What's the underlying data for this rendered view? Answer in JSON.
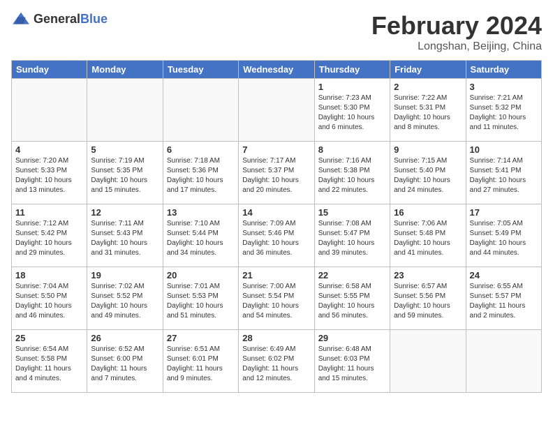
{
  "header": {
    "logo_general": "General",
    "logo_blue": "Blue",
    "month_title": "February 2024",
    "location": "Longshan, Beijing, China"
  },
  "weekdays": [
    "Sunday",
    "Monday",
    "Tuesday",
    "Wednesday",
    "Thursday",
    "Friday",
    "Saturday"
  ],
  "weeks": [
    [
      {
        "day": "",
        "sunrise": "",
        "sunset": "",
        "daylight": "",
        "empty": true
      },
      {
        "day": "",
        "sunrise": "",
        "sunset": "",
        "daylight": "",
        "empty": true
      },
      {
        "day": "",
        "sunrise": "",
        "sunset": "",
        "daylight": "",
        "empty": true
      },
      {
        "day": "",
        "sunrise": "",
        "sunset": "",
        "daylight": "",
        "empty": true
      },
      {
        "day": "1",
        "sunrise": "Sunrise: 7:23 AM",
        "sunset": "Sunset: 5:30 PM",
        "daylight": "Daylight: 10 hours and 6 minutes.",
        "empty": false
      },
      {
        "day": "2",
        "sunrise": "Sunrise: 7:22 AM",
        "sunset": "Sunset: 5:31 PM",
        "daylight": "Daylight: 10 hours and 8 minutes.",
        "empty": false
      },
      {
        "day": "3",
        "sunrise": "Sunrise: 7:21 AM",
        "sunset": "Sunset: 5:32 PM",
        "daylight": "Daylight: 10 hours and 11 minutes.",
        "empty": false
      }
    ],
    [
      {
        "day": "4",
        "sunrise": "Sunrise: 7:20 AM",
        "sunset": "Sunset: 5:33 PM",
        "daylight": "Daylight: 10 hours and 13 minutes.",
        "empty": false
      },
      {
        "day": "5",
        "sunrise": "Sunrise: 7:19 AM",
        "sunset": "Sunset: 5:35 PM",
        "daylight": "Daylight: 10 hours and 15 minutes.",
        "empty": false
      },
      {
        "day": "6",
        "sunrise": "Sunrise: 7:18 AM",
        "sunset": "Sunset: 5:36 PM",
        "daylight": "Daylight: 10 hours and 17 minutes.",
        "empty": false
      },
      {
        "day": "7",
        "sunrise": "Sunrise: 7:17 AM",
        "sunset": "Sunset: 5:37 PM",
        "daylight": "Daylight: 10 hours and 20 minutes.",
        "empty": false
      },
      {
        "day": "8",
        "sunrise": "Sunrise: 7:16 AM",
        "sunset": "Sunset: 5:38 PM",
        "daylight": "Daylight: 10 hours and 22 minutes.",
        "empty": false
      },
      {
        "day": "9",
        "sunrise": "Sunrise: 7:15 AM",
        "sunset": "Sunset: 5:40 PM",
        "daylight": "Daylight: 10 hours and 24 minutes.",
        "empty": false
      },
      {
        "day": "10",
        "sunrise": "Sunrise: 7:14 AM",
        "sunset": "Sunset: 5:41 PM",
        "daylight": "Daylight: 10 hours and 27 minutes.",
        "empty": false
      }
    ],
    [
      {
        "day": "11",
        "sunrise": "Sunrise: 7:12 AM",
        "sunset": "Sunset: 5:42 PM",
        "daylight": "Daylight: 10 hours and 29 minutes.",
        "empty": false
      },
      {
        "day": "12",
        "sunrise": "Sunrise: 7:11 AM",
        "sunset": "Sunset: 5:43 PM",
        "daylight": "Daylight: 10 hours and 31 minutes.",
        "empty": false
      },
      {
        "day": "13",
        "sunrise": "Sunrise: 7:10 AM",
        "sunset": "Sunset: 5:44 PM",
        "daylight": "Daylight: 10 hours and 34 minutes.",
        "empty": false
      },
      {
        "day": "14",
        "sunrise": "Sunrise: 7:09 AM",
        "sunset": "Sunset: 5:46 PM",
        "daylight": "Daylight: 10 hours and 36 minutes.",
        "empty": false
      },
      {
        "day": "15",
        "sunrise": "Sunrise: 7:08 AM",
        "sunset": "Sunset: 5:47 PM",
        "daylight": "Daylight: 10 hours and 39 minutes.",
        "empty": false
      },
      {
        "day": "16",
        "sunrise": "Sunrise: 7:06 AM",
        "sunset": "Sunset: 5:48 PM",
        "daylight": "Daylight: 10 hours and 41 minutes.",
        "empty": false
      },
      {
        "day": "17",
        "sunrise": "Sunrise: 7:05 AM",
        "sunset": "Sunset: 5:49 PM",
        "daylight": "Daylight: 10 hours and 44 minutes.",
        "empty": false
      }
    ],
    [
      {
        "day": "18",
        "sunrise": "Sunrise: 7:04 AM",
        "sunset": "Sunset: 5:50 PM",
        "daylight": "Daylight: 10 hours and 46 minutes.",
        "empty": false
      },
      {
        "day": "19",
        "sunrise": "Sunrise: 7:02 AM",
        "sunset": "Sunset: 5:52 PM",
        "daylight": "Daylight: 10 hours and 49 minutes.",
        "empty": false
      },
      {
        "day": "20",
        "sunrise": "Sunrise: 7:01 AM",
        "sunset": "Sunset: 5:53 PM",
        "daylight": "Daylight: 10 hours and 51 minutes.",
        "empty": false
      },
      {
        "day": "21",
        "sunrise": "Sunrise: 7:00 AM",
        "sunset": "Sunset: 5:54 PM",
        "daylight": "Daylight: 10 hours and 54 minutes.",
        "empty": false
      },
      {
        "day": "22",
        "sunrise": "Sunrise: 6:58 AM",
        "sunset": "Sunset: 5:55 PM",
        "daylight": "Daylight: 10 hours and 56 minutes.",
        "empty": false
      },
      {
        "day": "23",
        "sunrise": "Sunrise: 6:57 AM",
        "sunset": "Sunset: 5:56 PM",
        "daylight": "Daylight: 10 hours and 59 minutes.",
        "empty": false
      },
      {
        "day": "24",
        "sunrise": "Sunrise: 6:55 AM",
        "sunset": "Sunset: 5:57 PM",
        "daylight": "Daylight: 11 hours and 2 minutes.",
        "empty": false
      }
    ],
    [
      {
        "day": "25",
        "sunrise": "Sunrise: 6:54 AM",
        "sunset": "Sunset: 5:58 PM",
        "daylight": "Daylight: 11 hours and 4 minutes.",
        "empty": false
      },
      {
        "day": "26",
        "sunrise": "Sunrise: 6:52 AM",
        "sunset": "Sunset: 6:00 PM",
        "daylight": "Daylight: 11 hours and 7 minutes.",
        "empty": false
      },
      {
        "day": "27",
        "sunrise": "Sunrise: 6:51 AM",
        "sunset": "Sunset: 6:01 PM",
        "daylight": "Daylight: 11 hours and 9 minutes.",
        "empty": false
      },
      {
        "day": "28",
        "sunrise": "Sunrise: 6:49 AM",
        "sunset": "Sunset: 6:02 PM",
        "daylight": "Daylight: 11 hours and 12 minutes.",
        "empty": false
      },
      {
        "day": "29",
        "sunrise": "Sunrise: 6:48 AM",
        "sunset": "Sunset: 6:03 PM",
        "daylight": "Daylight: 11 hours and 15 minutes.",
        "empty": false
      },
      {
        "day": "",
        "sunrise": "",
        "sunset": "",
        "daylight": "",
        "empty": true
      },
      {
        "day": "",
        "sunrise": "",
        "sunset": "",
        "daylight": "",
        "empty": true
      }
    ]
  ]
}
